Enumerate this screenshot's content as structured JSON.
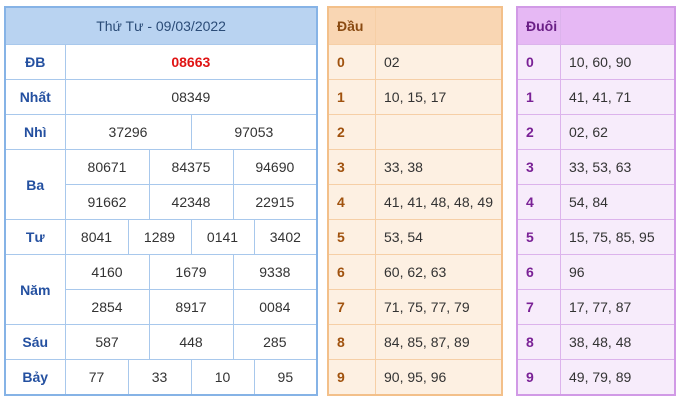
{
  "main": {
    "title": "Thứ Tư - 09/03/2022",
    "prizes": {
      "db": {
        "label": "ĐB",
        "values": [
          "08663"
        ]
      },
      "nhat": {
        "label": "Nhất",
        "values": [
          "08349"
        ]
      },
      "nhi": {
        "label": "Nhì",
        "values": [
          "37296",
          "97053"
        ]
      },
      "ba": {
        "label": "Ba",
        "values": [
          "80671",
          "84375",
          "94690",
          "91662",
          "42348",
          "22915"
        ]
      },
      "tu": {
        "label": "Tư",
        "values": [
          "8041",
          "1289",
          "0141",
          "3402"
        ]
      },
      "nam": {
        "label": "Năm",
        "values": [
          "4160",
          "1679",
          "9338",
          "2854",
          "8917",
          "0084"
        ]
      },
      "sau": {
        "label": "Sáu",
        "values": [
          "587",
          "448",
          "285"
        ]
      },
      "bay": {
        "label": "Bảy",
        "values": [
          "77",
          "33",
          "10",
          "95"
        ]
      }
    }
  },
  "dau": {
    "header": "Đầu",
    "rows": [
      {
        "key": "0",
        "vals": "02"
      },
      {
        "key": "1",
        "vals": "10, 15, 17"
      },
      {
        "key": "2",
        "vals": ""
      },
      {
        "key": "3",
        "vals": "33, 38"
      },
      {
        "key": "4",
        "vals": "41, 41, 48, 48, 49"
      },
      {
        "key": "5",
        "vals": "53, 54"
      },
      {
        "key": "6",
        "vals": "60, 62, 63"
      },
      {
        "key": "7",
        "vals": "71, 75, 77, 79"
      },
      {
        "key": "8",
        "vals": "84, 85, 87, 89"
      },
      {
        "key": "9",
        "vals": "90, 95, 96"
      }
    ]
  },
  "duoi": {
    "header": "Đuôi",
    "rows": [
      {
        "key": "0",
        "vals": "10, 60, 90"
      },
      {
        "key": "1",
        "vals": "41, 41, 71"
      },
      {
        "key": "2",
        "vals": "02, 62"
      },
      {
        "key": "3",
        "vals": "33, 53, 63"
      },
      {
        "key": "4",
        "vals": "54, 84"
      },
      {
        "key": "5",
        "vals": "15, 75, 85, 95"
      },
      {
        "key": "6",
        "vals": "96"
      },
      {
        "key": "7",
        "vals": "17, 77, 87"
      },
      {
        "key": "8",
        "vals": "38, 48, 48"
      },
      {
        "key": "9",
        "vals": "49, 79, 89"
      }
    ]
  }
}
